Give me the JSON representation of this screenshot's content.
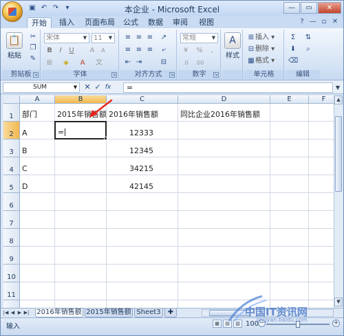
{
  "window": {
    "title": "本企业 - Microsoft Excel"
  },
  "ribbon": {
    "tabs": [
      "开始",
      "插入",
      "页面布局",
      "公式",
      "数据",
      "审阅",
      "视图"
    ],
    "groups": {
      "clipboard": {
        "label": "剪贴板",
        "paste": "粘贴"
      },
      "font": {
        "label": "字体",
        "name": "宋体",
        "size": "11",
        "bold": "B",
        "italic": "I",
        "underline": "U"
      },
      "alignment": {
        "label": "对齐方式"
      },
      "number": {
        "label": "数字",
        "format": "常规",
        "percent": "%",
        "comma": ","
      },
      "styles": {
        "label": "样式",
        "button": "样式"
      },
      "cells": {
        "label": "单元格",
        "insert": "插入",
        "delete": "删除",
        "format": "格式"
      },
      "editing": {
        "label": "编辑"
      }
    }
  },
  "formula_bar": {
    "name_box": "SUM",
    "fx": "fx",
    "content": "="
  },
  "sheet": {
    "columns": [
      "A",
      "B",
      "C",
      "D",
      "E",
      "F"
    ],
    "rows": [
      "1",
      "2",
      "3",
      "4",
      "5",
      "6",
      "7",
      "8",
      "9",
      "10",
      "11",
      "12"
    ],
    "selected_column": "B",
    "selected_row": "2",
    "cells": {
      "A1": "部门",
      "B1": "2015年销售额",
      "C1": "2016年销售额",
      "D1": "同比企业2016年销售额",
      "A2": "A",
      "B2": "=",
      "C2": "12333",
      "A3": "B",
      "C3": "12345",
      "A4": "C",
      "C4": "34215",
      "A5": "D",
      "C5": "42145"
    }
  },
  "sheet_tabs": [
    "2016年销售额",
    "2015年销售额",
    "Sheet3"
  ],
  "active_sheet": "2016年销售额",
  "status": {
    "mode": "输入",
    "zoom": "100%"
  },
  "watermark": {
    "text": "中国IT资讯网",
    "url": "jingyan.baidu.com"
  },
  "colors": {
    "accent": "#f1b94f",
    "ribbon": "#d6e4f5",
    "arrow": "#e8251c"
  }
}
